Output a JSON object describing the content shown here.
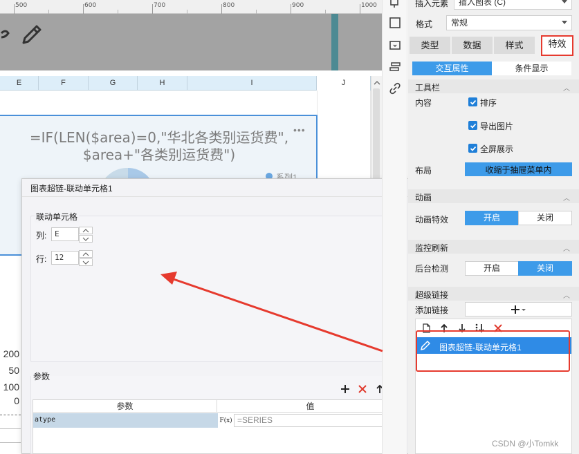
{
  "ruler": {
    "marks": [
      "500",
      "600",
      "700",
      "800",
      "900",
      "1000"
    ]
  },
  "columns": [
    "E",
    "F",
    "G",
    "H",
    "I",
    "J"
  ],
  "chart": {
    "title_line1": "=IF(LEN($area)=0,\"华北各类别运货费\",",
    "title_line2": "$area+\"各类别运货费\")",
    "more": "•••",
    "legend": "系列1",
    "axis_labels": [
      "200",
      "50",
      "100",
      "0"
    ]
  },
  "dialog": {
    "title": "图表超链-联动单元格1",
    "group_link_cell": "联动单元格",
    "col_label": "列:",
    "col_value": "E",
    "row_label": "行:",
    "row_value": "12",
    "group_params": "参数",
    "param_header_name": "参数",
    "param_header_value": "值",
    "param_row_name": "atype",
    "fx_label": "F(x)",
    "param_row_value": "=SERIES"
  },
  "panel": {
    "insert_element_label": "插入元素",
    "insert_chart_value": "插入图表 (C)",
    "format_label": "格式",
    "format_value": "常规",
    "tabs": [
      "类型",
      "数据",
      "样式",
      "特效"
    ],
    "active_tab": "特效",
    "subtabs": [
      "交互属性",
      "条件显示"
    ],
    "toolbar_section": "工具栏",
    "content_label": "内容",
    "checkboxes": [
      "排序",
      "导出图片",
      "全屏展示"
    ],
    "layout_label": "布局",
    "layout_value": "收缩于抽屉菜单内",
    "animation_section": "动画",
    "animation_effect_label": "动画特效",
    "animation_on": "开启",
    "animation_off": "关闭",
    "monitor_section": "监控刷新",
    "bg_check_label": "后台检测",
    "bg_on": "开启",
    "bg_off": "关闭",
    "hyperlink_section": "超级链接",
    "add_link_label": "添加链接",
    "link_item": "图表超链-联动单元格1"
  },
  "watermark": "CSDN @小Tomkk",
  "colors": {
    "accent": "#3d9be9",
    "highlight_red": "#e63a2e",
    "chart_border": "#4a90d9"
  }
}
